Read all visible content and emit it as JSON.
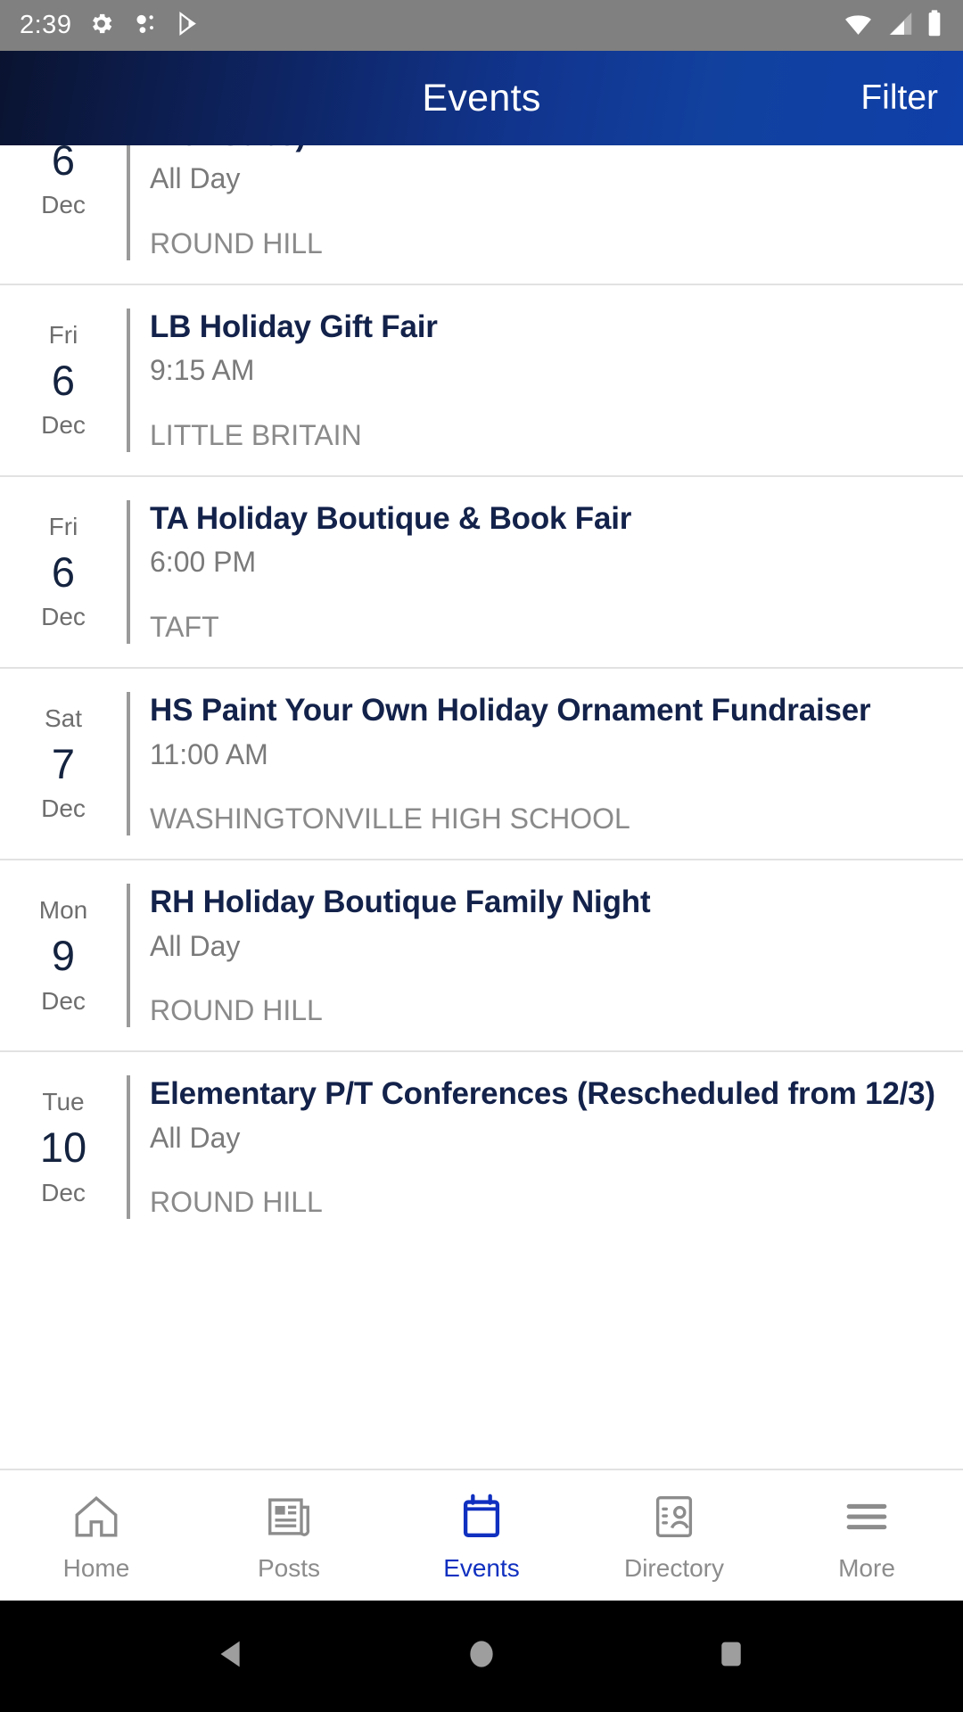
{
  "status_bar": {
    "time": "2:39",
    "left_icons": [
      "gear-icon",
      "bluetooth-dots-icon",
      "play-store-icon"
    ],
    "right_icons": [
      "wifi-icon",
      "cell-signal-icon",
      "battery-icon"
    ],
    "background_color": "#808080"
  },
  "app_bar": {
    "title": "Events",
    "action_label": "Filter",
    "gradient_from": "#0a1330",
    "gradient_to": "#0f3fa8"
  },
  "events": [
    {
      "dow": "",
      "day": "6",
      "month": "Dec",
      "title": "with Subs)",
      "time": "All Day",
      "location": "ROUND HILL",
      "clipped": true
    },
    {
      "dow": "Fri",
      "day": "6",
      "month": "Dec",
      "title": "LB Holiday Gift Fair",
      "time": "9:15 AM",
      "location": "LITTLE BRITAIN",
      "clipped": false
    },
    {
      "dow": "Fri",
      "day": "6",
      "month": "Dec",
      "title": "TA Holiday Boutique & Book Fair",
      "time": "6:00 PM",
      "location": "TAFT",
      "clipped": false
    },
    {
      "dow": "Sat",
      "day": "7",
      "month": "Dec",
      "title": "HS Paint Your Own Holiday Ornament Fundraiser",
      "time": "11:00 AM",
      "location": "WASHINGTONVILLE HIGH SCHOOL",
      "clipped": false
    },
    {
      "dow": "Mon",
      "day": "9",
      "month": "Dec",
      "title": "RH Holiday Boutique Family Night",
      "time": "All Day",
      "location": "ROUND HILL",
      "clipped": false
    },
    {
      "dow": "Tue",
      "day": "10",
      "month": "Dec",
      "title": "Elementary P/T Conferences (Rescheduled from 12/3)",
      "time": "All Day",
      "location": "ROUND HILL",
      "clipped": false
    }
  ],
  "bottom_nav": {
    "active_color": "#1030c0",
    "inactive_color": "#8c8c8c",
    "items": [
      {
        "label": "Home",
        "icon": "home-icon",
        "active": false
      },
      {
        "label": "Posts",
        "icon": "newspaper-icon",
        "active": false
      },
      {
        "label": "Events",
        "icon": "calendar-icon",
        "active": true
      },
      {
        "label": "Directory",
        "icon": "contact-card-icon",
        "active": false
      },
      {
        "label": "More",
        "icon": "hamburger-icon",
        "active": false
      }
    ]
  },
  "system_nav": {
    "buttons": [
      "back-triangle-icon",
      "home-circle-icon",
      "recents-square-icon"
    ],
    "background_color": "#000000"
  }
}
